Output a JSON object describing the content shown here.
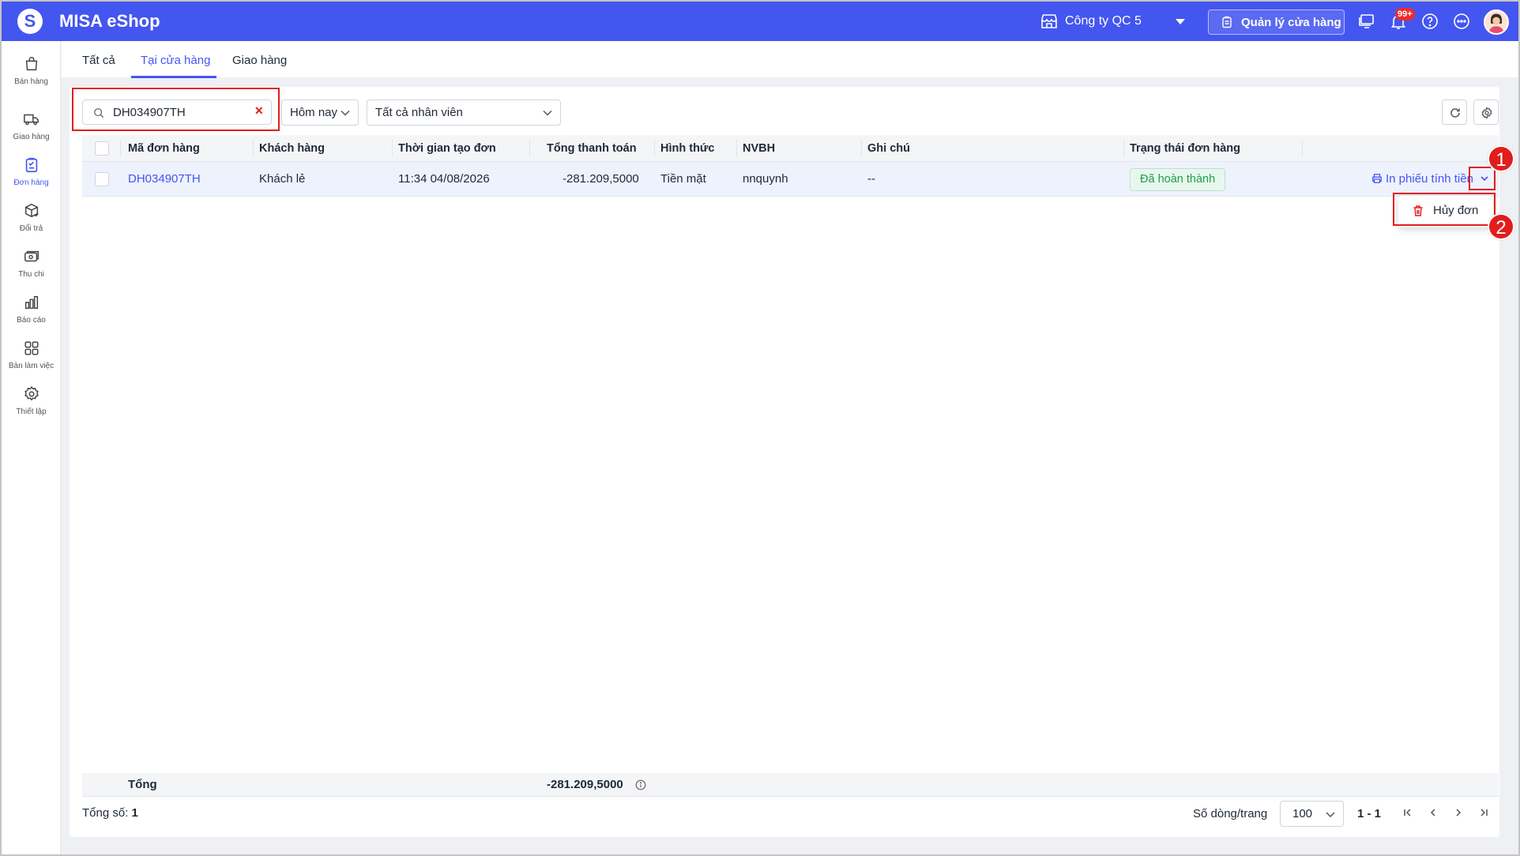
{
  "header": {
    "app_title": "MISA eShop",
    "logo_letter": "S",
    "store_name": "Công ty QC 5",
    "manage_store_label": "Quản lý cửa hàng",
    "notification_badge": "99+",
    "brand_color": "#4456f0"
  },
  "sidebar": {
    "items": [
      {
        "label": "Bán hàng",
        "icon": "bag-icon"
      },
      {
        "label": "Giao hàng",
        "icon": "truck-icon"
      },
      {
        "label": "Đơn hàng",
        "icon": "clipboard-icon",
        "active": true
      },
      {
        "label": "Đổi trả",
        "icon": "return-box-icon"
      },
      {
        "label": "Thu chi",
        "icon": "cash-icon"
      },
      {
        "label": "Báo cáo",
        "icon": "bar-chart-icon"
      },
      {
        "label": "Bàn làm việc",
        "icon": "grid-icon"
      },
      {
        "label": "Thiết lập",
        "icon": "gear-icon"
      }
    ]
  },
  "tabs": [
    {
      "label": "Tất cả"
    },
    {
      "label": "Tại cửa hàng",
      "active": true
    },
    {
      "label": "Giao hàng"
    }
  ],
  "filters": {
    "search_value": "DH034907TH",
    "date_range": "Hôm nay",
    "employee": "Tất cả nhân viên"
  },
  "table": {
    "columns": [
      "Mã đơn hàng",
      "Khách hàng",
      "Thời gian tạo đơn",
      "Tổng thanh toán",
      "Hình thức",
      "NVBH",
      "Ghi chú",
      "Trạng thái đơn hàng"
    ],
    "rows": [
      {
        "order_code": "DH034907TH",
        "customer": "Khách lẻ",
        "created_at": "11:34 04/08/2026",
        "total": "-281.209,5000",
        "payment": "Tiền mặt",
        "seller": "nnquynh",
        "note": "--",
        "status": "Đã hoàn thành",
        "print_action": "In phiếu tính tiền"
      }
    ]
  },
  "row_menu": {
    "cancel_label": "Hủy đơn"
  },
  "callouts": [
    "1",
    "2"
  ],
  "summary": {
    "label": "Tổng",
    "total": "-281.209,5000"
  },
  "footer": {
    "count_label": "Tổng số:",
    "count_value": "1",
    "rows_per_page_label": "Số dòng/trang",
    "rows_per_page": "100",
    "range": "1 - 1"
  }
}
